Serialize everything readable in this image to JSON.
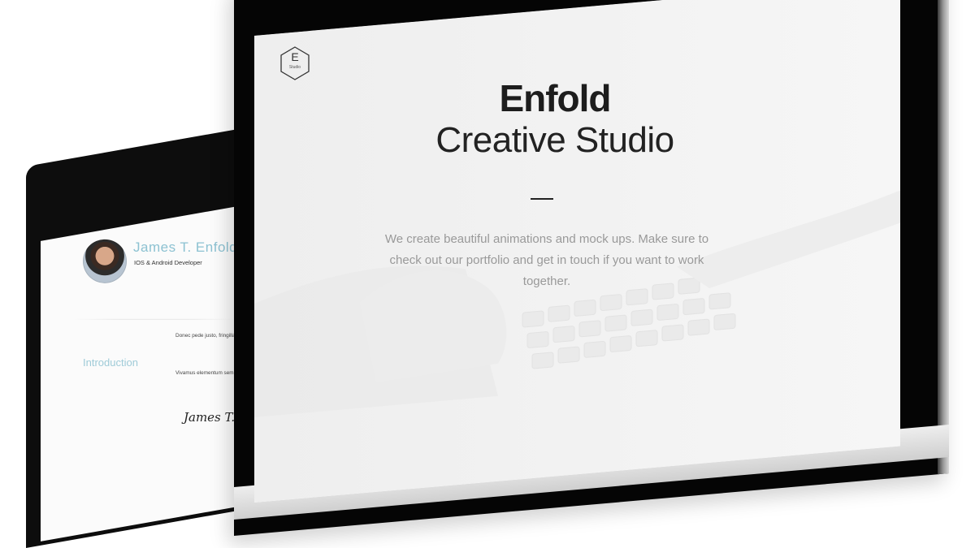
{
  "back_device": {
    "profile": {
      "name": "James T. Enfold",
      "role": "IOS & Android Developer"
    },
    "intro": {
      "heading": "Introduction",
      "paragraph_1": "Donec pede justo, fringilla ut, imperdiet a, venenatis Integer tincidunt. Cras dap",
      "paragraph_2": "Vivamus elementum semp porttitor eu, consequat vit quis, feugiat a, tellus.",
      "signature": "James T. Enfold"
    }
  },
  "front_monitor": {
    "logo": {
      "letter": "E",
      "sub": "Studio"
    },
    "hero": {
      "title": "Enfold",
      "subtitle": "Creative Studio",
      "text": "We create beautiful animations and mock ups. Make sure to check out our portfolio and get in touch if you want to work together."
    }
  },
  "colors": {
    "accent_light_blue": "#8dc2d2",
    "bezel": "#050505",
    "screen_bg": "#f5f5f5",
    "body_text": "#999999"
  }
}
